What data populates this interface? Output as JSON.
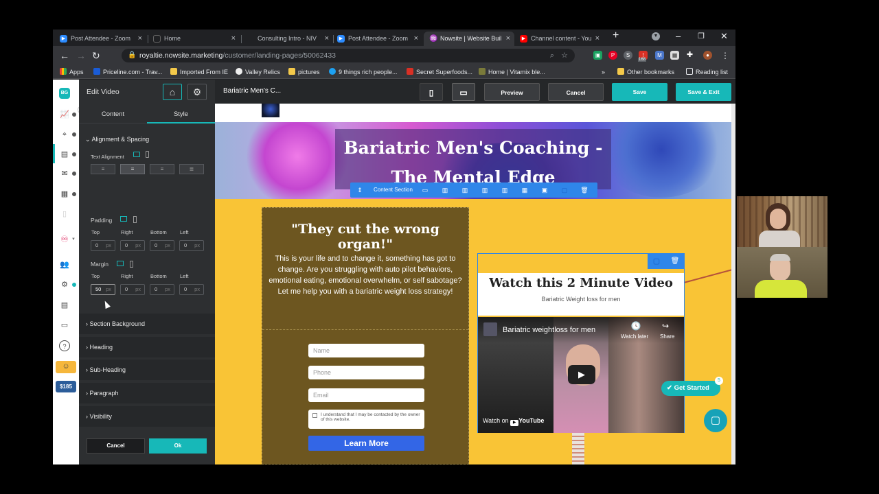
{
  "tabs": [
    {
      "title": "Post Attendee - Zoom",
      "icon": "zoom-icon"
    },
    {
      "title": "Home",
      "icon": "page-icon"
    },
    {
      "title": "Consulting Intro - NIV",
      "icon": "page-icon"
    },
    {
      "title": "Post Attendee - Zoom",
      "icon": "zoom-icon"
    },
    {
      "title": "Nowsite | Website Buil",
      "icon": "nowsite-icon",
      "active": true
    },
    {
      "title": "Channel content - You",
      "icon": "youtube-icon"
    }
  ],
  "address": {
    "domain": "royaltie.nowsite.marketing",
    "path": "/customer/landing-pages/50062433"
  },
  "extensions": {
    "badge_count": "168"
  },
  "bookmarks": [
    {
      "label": "Apps"
    },
    {
      "label": "Priceline.com - Trav..."
    },
    {
      "label": "Imported From IE"
    },
    {
      "label": "Valley Relics"
    },
    {
      "label": "pictures"
    },
    {
      "label": "9 things rich people..."
    },
    {
      "label": "Secret Superfoods..."
    },
    {
      "label": "Home | Vitamix ble..."
    },
    {
      "label": "»"
    },
    {
      "label": "Other bookmarks"
    },
    {
      "label": "Reading list"
    }
  ],
  "rail": {
    "avatar": "BG",
    "credit": "$185"
  },
  "panel": {
    "title": "Edit Video",
    "tabs": [
      "Content",
      "Style"
    ],
    "section": "Alignment & Spacing",
    "text_alignment": "Text Alignment",
    "padding_label": "Padding",
    "margin_label": "Margin",
    "sides": [
      "Top",
      "Right",
      "Bottom",
      "Left"
    ],
    "padding_values": [
      "0",
      "0",
      "0",
      "0"
    ],
    "margin_values": [
      "50",
      "0",
      "0",
      "0"
    ],
    "unit": "px",
    "accordions": [
      "Section Background",
      "Heading",
      "Sub-Heading",
      "Paragraph",
      "Visibility"
    ],
    "cancel": "Cancel",
    "ok": "Ok"
  },
  "editor_top": {
    "page_name": "Bariatric Men's C...",
    "preview": "Preview",
    "cancel": "Cancel",
    "save": "Save",
    "save_exit": "Save & Exit"
  },
  "page": {
    "headline": "Bariatric Men's Coaching - The Mental Edge",
    "section_toolbar_label": "Content Section",
    "card_title": "\"They cut the wrong organ!\"",
    "card_body": "This is your life and to change it, something has got to change. Are you struggling with auto pilot behaviors, emotional eating, emotional overwhelm, or self sabotage? Let me help you with a bariatric weight loss strategy!",
    "form": {
      "name_placeholder": "Name",
      "phone_placeholder": "Phone",
      "email_placeholder": "Email",
      "consent": "I understand that I may be contacted by the owner of this website.",
      "submit": "Learn More"
    },
    "video_title": "Watch this 2 Minute Video",
    "video_subtitle": "Bariatric Weight loss for men",
    "yt": {
      "title": "Bariatric weightloss for men",
      "watch_later": "Watch later",
      "share": "Share",
      "watch_on": "Watch on",
      "brand": "YouTube"
    },
    "get_started": "Get Started",
    "get_started_badge": "5"
  },
  "colors": {
    "teal": "#17b8b8",
    "page_yellow": "#f9c436",
    "card_brown": "#6d5620",
    "learn_more_blue": "#3366e6"
  }
}
